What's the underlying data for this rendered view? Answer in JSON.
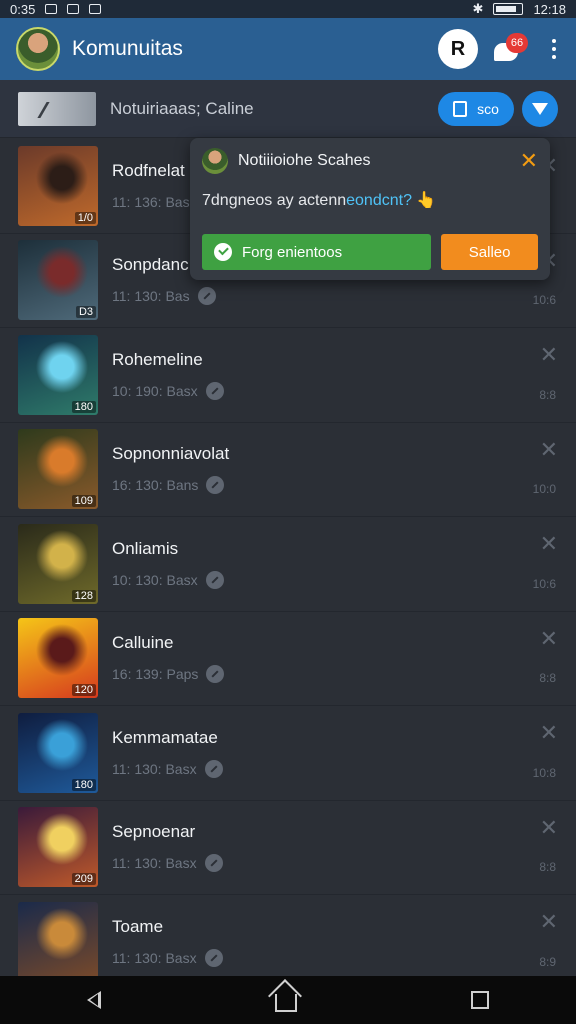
{
  "status_bar": {
    "time_left": "0:35",
    "time_right": "12:18"
  },
  "header": {
    "title": "Komunuitas",
    "profile_letter": "R",
    "chat_badge": "66"
  },
  "sub_header": {
    "title": "Notuiriaaas; Caline",
    "button_label": "sco"
  },
  "popup": {
    "title": "Notiiioiohe Scahes",
    "message_prefix": "7dngneos ay actenn",
    "message_highlight": "eondcnt?",
    "message_suffix": " 👆",
    "primary_label": "Forg enientoos",
    "secondary_label": "Salleo"
  },
  "items": [
    {
      "name": "Rodfnelat",
      "meta": "11: 136: Bas",
      "time": "",
      "badge": "1/0",
      "colors": [
        "#6b3a2a",
        "#c06a2b",
        "#2c1d17"
      ]
    },
    {
      "name": "Sonpdanc",
      "meta": "11: 130: Bas",
      "time": "10:6",
      "badge": "D3",
      "colors": [
        "#1d2f3a",
        "#4f6a7a",
        "#7a2b2b"
      ]
    },
    {
      "name": "Rohemeline",
      "meta": "10: 190: Basx",
      "time": "8:8",
      "badge": "180",
      "colors": [
        "#12324a",
        "#2f7b6a",
        "#6fd3ef"
      ]
    },
    {
      "name": "Sopnonniavolat",
      "meta": "16: 130: Bans",
      "time": "10:0",
      "badge": "109",
      "colors": [
        "#2e3a1c",
        "#8a5a2b",
        "#d97b2b"
      ]
    },
    {
      "name": "Onliamis",
      "meta": "10: 130: Basx",
      "time": "10:6",
      "badge": "128",
      "colors": [
        "#2a2a1a",
        "#6f6a2a",
        "#d2b24a"
      ]
    },
    {
      "name": "Calluine",
      "meta": "16: 139: Paps",
      "time": "8:8",
      "badge": "120",
      "colors": [
        "#f5c518",
        "#d63a1e",
        "#5a1a1a"
      ]
    },
    {
      "name": "Kemmamatae",
      "meta": "11: 130: Basx",
      "time": "10:8",
      "badge": "180",
      "colors": [
        "#0f1d3f",
        "#1f5a9a",
        "#3aa0d8"
      ]
    },
    {
      "name": "Sepnoenar",
      "meta": "11: 130: Basx",
      "time": "8:8",
      "badge": "209",
      "colors": [
        "#3a1a3a",
        "#c05a2a",
        "#f0d060"
      ]
    },
    {
      "name": "Toame",
      "meta": "11: 130: Basx",
      "time": "8:9",
      "badge": "",
      "colors": [
        "#1a2a4a",
        "#7a4a2a",
        "#c98a3a"
      ]
    }
  ]
}
